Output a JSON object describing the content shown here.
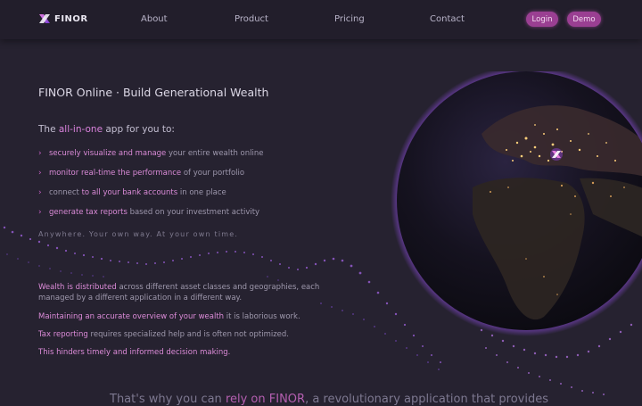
{
  "brand": {
    "name": "FINOR"
  },
  "nav": {
    "items": [
      "About",
      "Product",
      "Pricing",
      "Contact"
    ]
  },
  "actions": {
    "login": "Login",
    "demo": "Demo"
  },
  "hero": {
    "headline": "FINOR Online · Build Generational Wealth",
    "intro_pre": "The ",
    "intro_accent": "all-in-one",
    "intro_post": " app for you to:",
    "features": [
      {
        "hl": "securely visualize and manage",
        "rest": " your entire wealth online"
      },
      {
        "hl": "monitor real-time the performance",
        "rest": " of your portfolio"
      },
      {
        "pre": "connect ",
        "hl": "to all your bank accounts",
        "rest": " in one place"
      },
      {
        "hl": "generate tax reports",
        "rest": " based on your investment activity"
      }
    ],
    "tagline": "Anywhere. Your own way. At your own time."
  },
  "problem": {
    "p1_hl": "Wealth is distributed",
    "p1_rest": " across different asset classes and geographies, each managed by a different application in a different way.",
    "p2_hl": "Maintaining an accurate overview of your wealth",
    "p2_rest": " it is laborious work.",
    "p3_hl": "Tax reporting",
    "p3_rest": " requires specialized help and is often not optimized.",
    "p4": "This hinders timely and informed decision making."
  },
  "bottom": {
    "pre": "That's why you can ",
    "hl": "rely on FINOR",
    "post": ", a revolutionary application that provides"
  },
  "colors": {
    "background": "#262230",
    "accent": "#d982dc",
    "button": "#9a3f92"
  },
  "icons": {
    "logo": "finor-logo-icon",
    "bullet": "chevron-right-icon",
    "marker": "finor-marker-icon"
  }
}
